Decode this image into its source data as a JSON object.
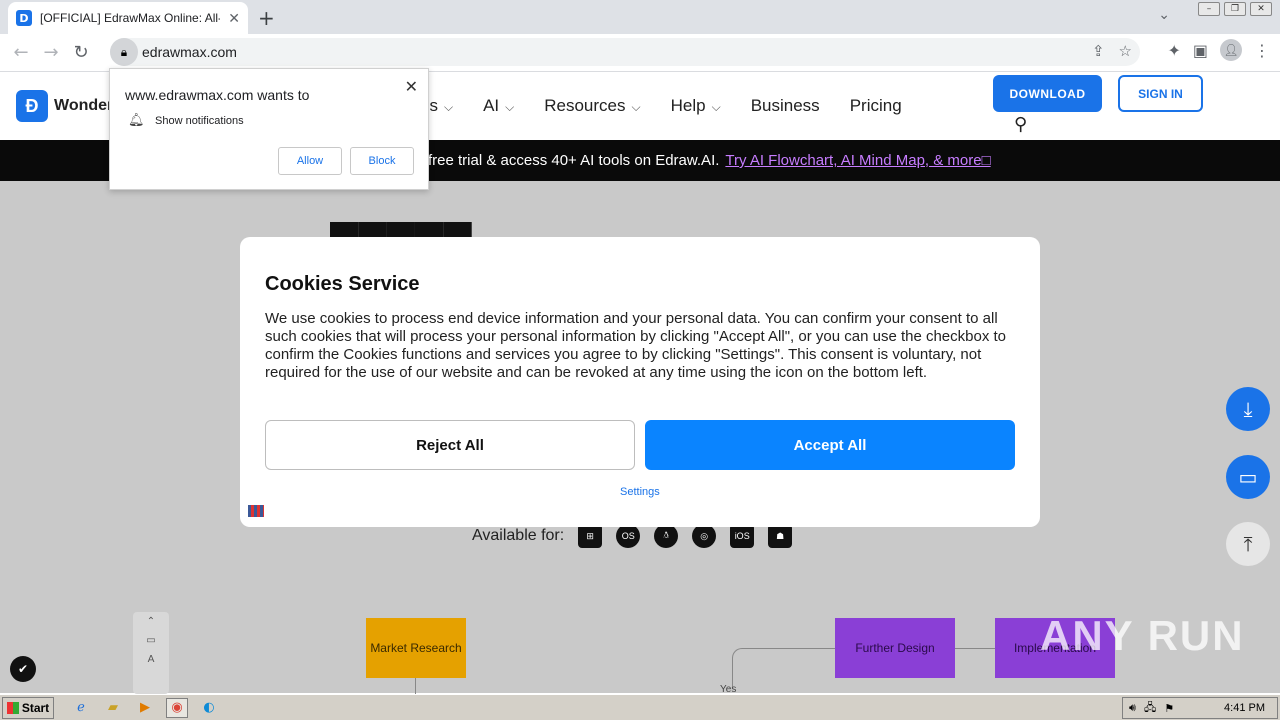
{
  "browser": {
    "tab_title": "[OFFICIAL] EdrawMax Online: All-in-",
    "favicon_letter": "D",
    "url": "edrawmax.com",
    "icons": {
      "back": "back-arrow-icon",
      "forward": "forward-arrow-icon",
      "reload": "reload-icon",
      "lock": "lock-icon",
      "share": "share-icon",
      "bookmark": "star-icon",
      "extensions": "puzzle-icon",
      "sidepanel": "sidepanel-icon",
      "profile": "profile-icon",
      "menu": "kebab-menu-icon"
    }
  },
  "site": {
    "logo_text": "Wonder",
    "nav": {
      "item1": "ns",
      "item2": "AI",
      "item3": "Resources",
      "item4": "Help",
      "item5": "Business",
      "item6": "Pricing"
    },
    "download_label": "DOWNLOAD",
    "signin_label": "SIGN IN",
    "promo_text": "free trial & access 40+ AI tools on Edraw.AI.",
    "promo_link": "Try AI Flowchart, AI Mind Map, & more□",
    "available_label": "Available for:",
    "os": {
      "macos": "OS",
      "ios": "iOS"
    },
    "nodes": {
      "market": "Market Research",
      "further": "Further Design",
      "impl": "Implementation",
      "yes": "Yes"
    },
    "accent_color": "#1a73e8"
  },
  "notification": {
    "title": "www.edrawmax.com wants to",
    "permission": "Show notifications",
    "allow": "Allow",
    "block": "Block"
  },
  "cookie": {
    "title": "Cookies Service",
    "text": "We use cookies to process end device information and your personal data. You can confirm your consent to all such cookies that will process your personal information by clicking \"Accept All\", or you can use the checkbox to confirm the Cookies functions and services you agree to by clicking \"Settings\". This consent is voluntary, not required for the use of our website and can be revoked at any time using the icon on the bottom left.",
    "reject": "Reject All",
    "accept": "Accept All",
    "settings": "Settings"
  },
  "watermark": "ANY RUN",
  "taskbar": {
    "start": "Start",
    "clock": "4:41 PM"
  }
}
